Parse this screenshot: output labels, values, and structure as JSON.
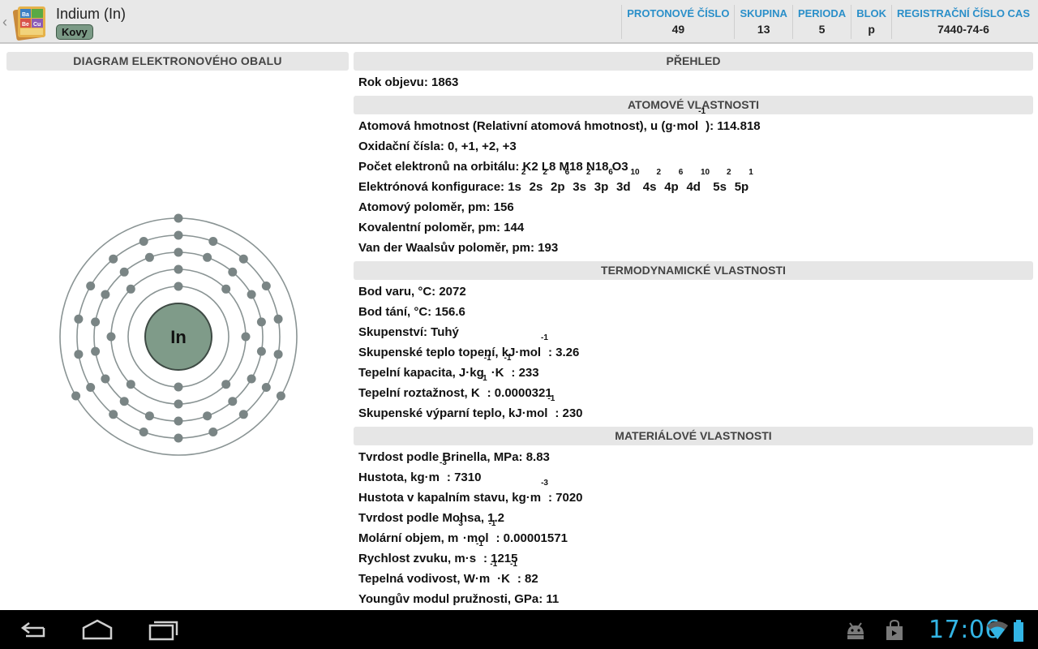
{
  "app": {
    "title": "Indium (In)",
    "category": "Kovy",
    "icon_letters": [
      "Ba",
      "Be",
      "Cu"
    ]
  },
  "stats": [
    {
      "label": "PROTONOVÉ ČÍSLO",
      "value": "49"
    },
    {
      "label": "SKUPINA",
      "value": "13"
    },
    {
      "label": "PERIODA",
      "value": "5"
    },
    {
      "label": "BLOK",
      "value": "p"
    },
    {
      "label": "REGISTRAČNÍ ČÍSLO CAS",
      "value": "7440-74-6"
    }
  ],
  "diagram": {
    "header": "DIAGRAM ELEKTRONOVÉHO OBALU",
    "symbol": "In",
    "shells": [
      2,
      8,
      18,
      18,
      3
    ],
    "nucleus_color": "#7f9b89",
    "electron_color": "#7a8585"
  },
  "sections": [
    {
      "title": "PŘEHLED",
      "rows": [
        {
          "parts": [
            "Rok objevu: 1863"
          ]
        }
      ]
    },
    {
      "title": "ATOMOVÉ VLASTNOSTI",
      "rows": [
        {
          "parts": [
            "Atomová hmotnost (Relativní atomová hmotnost), u (g·mol",
            {
              "sup": "-1"
            },
            "): 114.818"
          ]
        },
        {
          "parts": [
            "Oxidační čísla: 0, +1, +2, +3"
          ]
        },
        {
          "parts": [
            "Počet elektronů na orbitálu: K2 L8 M18 N18 O3"
          ]
        },
        {
          "parts": [
            "Elektrónová konfigurace: 1s",
            {
              "sup": "2"
            },
            " 2s",
            {
              "sup": "2"
            },
            " 2p",
            {
              "sup": "6"
            },
            " 3s",
            {
              "sup": "2"
            },
            " 3p",
            {
              "sup": "6"
            },
            " 3d",
            {
              "sup": "10"
            },
            " 4s",
            {
              "sup": "2"
            },
            " 4p",
            {
              "sup": "6"
            },
            " 4d",
            {
              "sup": "10"
            },
            " 5s",
            {
              "sup": "2"
            },
            " 5p",
            {
              "sup": "1"
            }
          ]
        },
        {
          "parts": [
            "Atomový poloměr, pm: 156"
          ]
        },
        {
          "parts": [
            "Kovalentní poloměr, pm: 144"
          ]
        },
        {
          "parts": [
            "Van der Waalsův poloměr, pm: 193"
          ]
        }
      ]
    },
    {
      "title": "TERMODYNAMICKÉ VLASTNOSTI",
      "rows": [
        {
          "parts": [
            "Bod varu, °C: 2072"
          ]
        },
        {
          "parts": [
            "Bod tání, °C: 156.6"
          ]
        },
        {
          "parts": [
            "Skupenství: Tuhý"
          ]
        },
        {
          "parts": [
            "Skupenské teplo topení, kJ·mol",
            {
              "sup": "-1"
            },
            ": 3.26"
          ]
        },
        {
          "parts": [
            "Tepelní kapacita, J·kg",
            {
              "sup": "-1"
            },
            "·K",
            {
              "sup": "-1"
            },
            ": 233"
          ]
        },
        {
          "parts": [
            "Tepelní roztažnost, K",
            {
              "sup": "-1"
            },
            ": 0.0000321"
          ]
        },
        {
          "parts": [
            "Skupenské výparní teplo, kJ·mol",
            {
              "sup": "-1"
            },
            ": 230"
          ]
        }
      ]
    },
    {
      "title": "MATERIÁLOVÉ VLASTNOSTI",
      "rows": [
        {
          "parts": [
            "Tvrdost podle Brinella, MPa: 8.83"
          ]
        },
        {
          "parts": [
            "Hustota, kg·m",
            {
              "sup": "-3"
            },
            ": 7310"
          ]
        },
        {
          "parts": [
            "Hustota v kapalním stavu, kg·m",
            {
              "sup": "-3"
            },
            ": 7020"
          ]
        },
        {
          "parts": [
            "Tvrdost podle Mohsa, 1.2"
          ]
        },
        {
          "parts": [
            "Molární objem, m",
            {
              "sup": "3"
            },
            "·mol",
            {
              "sup": "-1"
            },
            ": 0.00001571"
          ]
        },
        {
          "parts": [
            "Rychlost zvuku, m·s",
            {
              "sup": "-1"
            },
            ": 1215"
          ]
        },
        {
          "parts": [
            "Tepelná vodivost, W·m",
            {
              "sup": "-1"
            },
            "·K",
            {
              "sup": "-1"
            },
            ": 82"
          ]
        },
        {
          "parts": [
            "Youngův modul pružnosti, GPa: 11"
          ]
        }
      ]
    }
  ],
  "navbar": {
    "buttons": [
      "back-icon",
      "home-icon",
      "recent-apps-icon"
    ],
    "status_icons": [
      "android-debug-icon",
      "shop-bag-icon",
      "wifi-icon",
      "battery-icon"
    ],
    "time": "17:06",
    "accent": "#33b5e5"
  }
}
